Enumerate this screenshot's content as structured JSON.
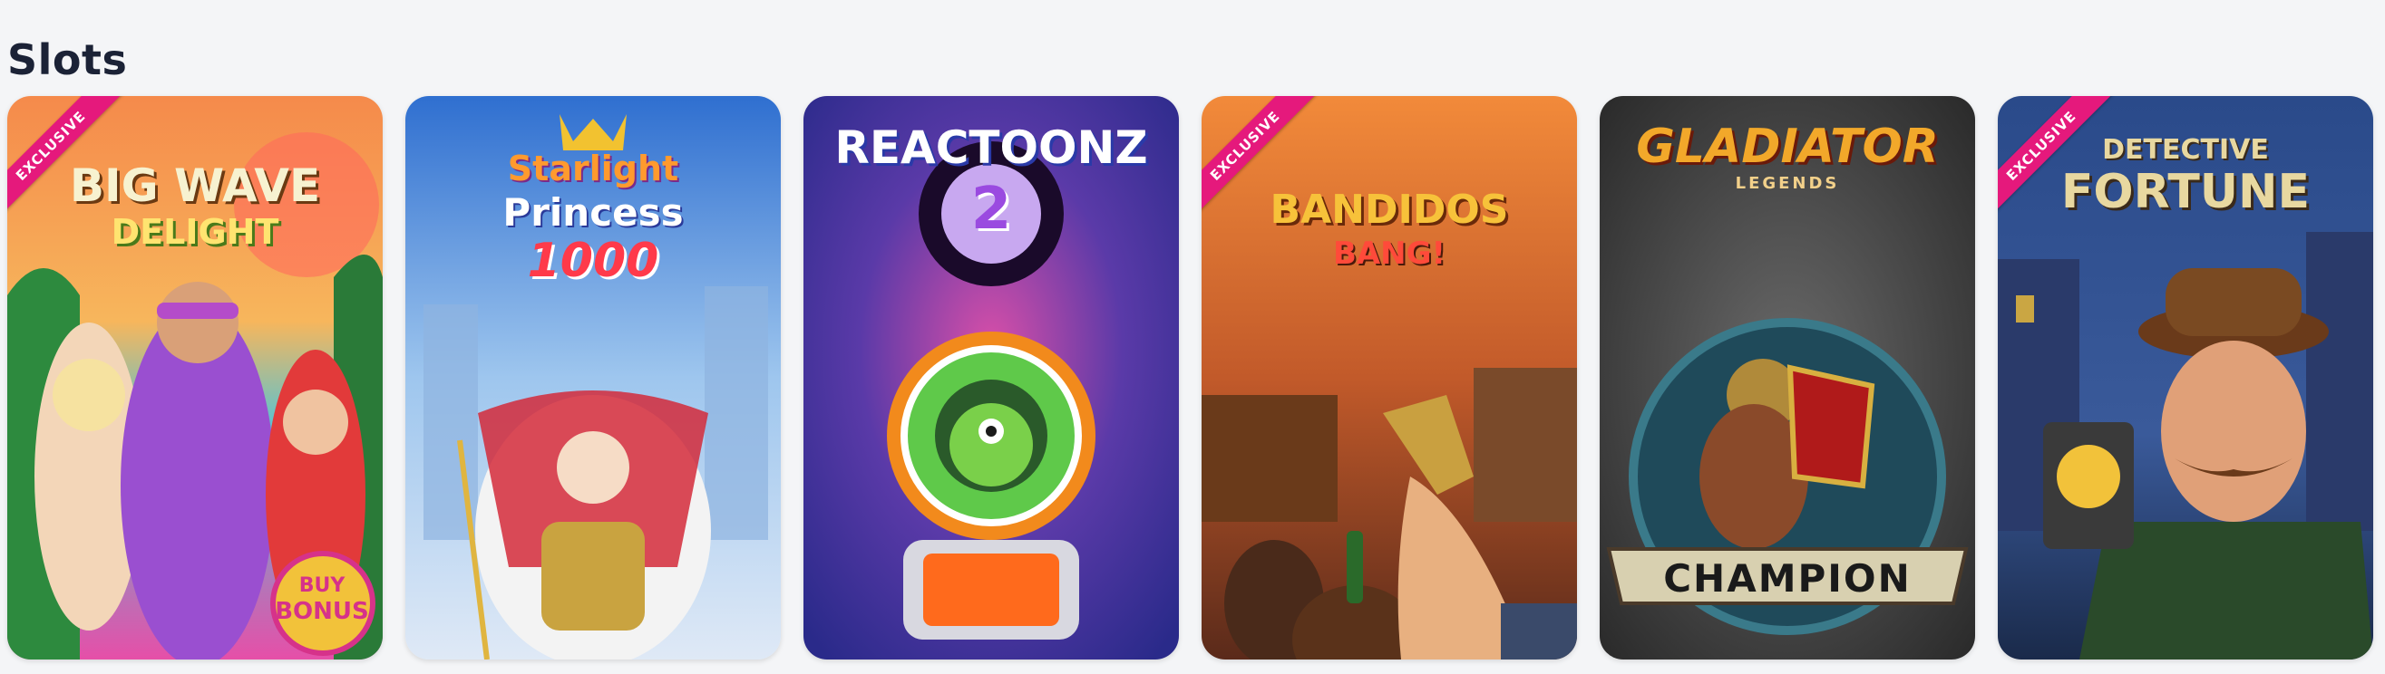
{
  "section": {
    "title": "Slots"
  },
  "exclusive_label": "EXCLUSIVE",
  "games": [
    {
      "name": "Big Wave Delight",
      "logo_line1": "BIG WAVE",
      "logo_line2": "DELIGHT",
      "badge_line1": "BUY",
      "badge_line2": "BONUS",
      "exclusive": true
    },
    {
      "name": "Starlight Princess 1000",
      "logo_line1": "Starlight",
      "logo_line2": "Princess",
      "logo_line3": "1000",
      "exclusive": false
    },
    {
      "name": "Reactoonz 2",
      "logo_line1": "REACTOONZ",
      "logo_line2": "2",
      "exclusive": false
    },
    {
      "name": "Bandidos Bang!",
      "logo_line1": "BANDIDOS",
      "logo_line2": "BANG!",
      "exclusive": true
    },
    {
      "name": "Gladiator Legends",
      "logo_line1": "GLADIATOR",
      "logo_line2": "LEGENDS",
      "banner": "CHAMPION",
      "exclusive": false
    },
    {
      "name": "Detective Fortune",
      "logo_line1": "DETECTIVE",
      "logo_line2": "FORTUNE",
      "exclusive": true
    }
  ],
  "colors": {
    "page_bg": "#f4f5f7",
    "title": "#1b2236",
    "exclusive_ribbon": "#e5197c"
  }
}
